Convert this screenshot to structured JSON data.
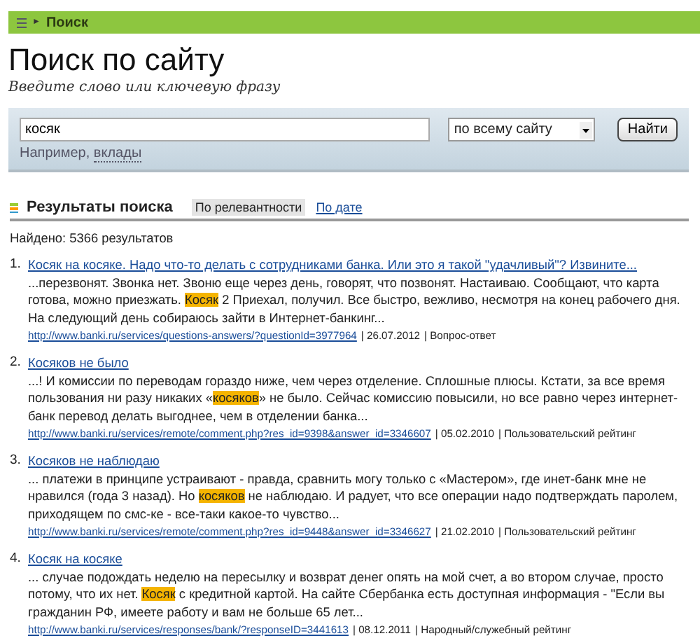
{
  "breadcrumb": {
    "arrow": "►",
    "label": "Поиск"
  },
  "title": "Поиск по сайту",
  "subtitle": "Введите слово или ключевую фразу",
  "search": {
    "value": "косяк",
    "scope": "по всему сайту",
    "button": "Найти",
    "example_label": "Например,",
    "example_link": "вклады"
  },
  "results_header": {
    "title": "Результаты поиска",
    "tabs": [
      {
        "label": "По релевантности",
        "selected": true
      },
      {
        "label": "По дате",
        "selected": false
      }
    ]
  },
  "found": "Найдено: 5366 результатов",
  "results": [
    {
      "number": "1.",
      "title": "Косяк на косяке. Надо что-то делать с сотрудниками банка. Или это я такой \"удачливый\"? Извините...",
      "snippet": "...перезвонят. Звонка нет. Звоню еще через день, говорят, что позвонят. Настаиваю. Сообщают, что карта готова, можно приезжать. **Косяк** 2 Приехал, получил. Все быстро, вежливо, несмотря на конец рабочего дня. На следующий день собираюсь зайти в Интернет-банкинг...",
      "url": "http://www.banki.ru/services/questions-answers/?questionId=3977964",
      "date": "| 26.07.2012",
      "category": "| Вопрос-ответ"
    },
    {
      "number": "2.",
      "title": "Косяков не было",
      "snippet": "...! И комиссии по переводам гораздо ниже, чем через отделение.  Сплошные плюсы. Кстати, за все время пользования ни разу никаких «**косяков**» не было. Сейчас комиссию повысили, но все равно через интернет-банк перевод делать выгоднее, чем в отделении банка...",
      "url": "http://www.banki.ru/services/remote/comment.php?res_id=9398&answer_id=3346607",
      "date": "| 05.02.2010",
      "category": "| Пользовательский рейтинг"
    },
    {
      "number": "3.",
      "title": "Косяков не наблюдаю",
      "snippet": "... платежи в принципе устраивают - правда, сравнить могу только с «Мастером», где инет-банк мне не нравился (года 3 назад). Но **косяков** не наблюдаю. И радует, что все операции надо подтверждать паролем, приходящем по смс-ке - все-таки какое-то чувство...",
      "url": "http://www.banki.ru/services/remote/comment.php?res_id=9448&answer_id=3346627",
      "date": "| 21.02.2010",
      "category": "| Пользовательский рейтинг"
    },
    {
      "number": "4.",
      "title": "Косяк на косяке",
      "snippet": "... случае подождать неделю на пересылку и возврат денег опять на мой счет, а во втором случае, просто потому, что их нет. **Косяк** с кредитной картой. На сайте Сбербанка есть доступная информация - \"Если вы гражданин РФ, имеете работу и вам не больше 65 лет...",
      "url": "http://www.banki.ru/services/responses/bank/?responseID=3441613",
      "date": "| 08.12.2011",
      "category": "| Народный/служебный рейтинг"
    }
  ]
}
